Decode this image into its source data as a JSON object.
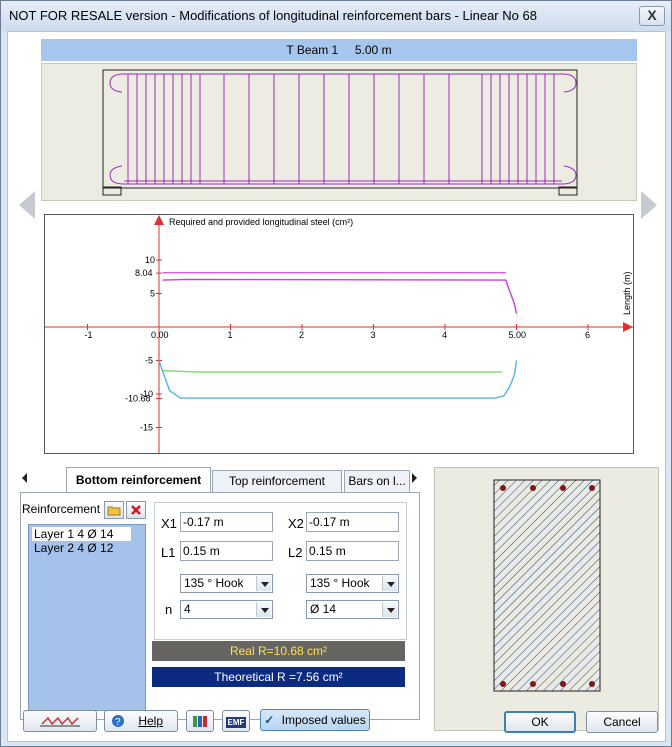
{
  "window": {
    "title": "NOT FOR RESALE version - Modifications of longitudinal reinforcement bars - Linear No 68",
    "close_label": "X"
  },
  "beam": {
    "header": "T Beam 1     5.00 m"
  },
  "chart_data": {
    "type": "line",
    "title": "Required and provided longitudinal steel (cm²)",
    "xlabel": "Length (m)",
    "ylabel": "",
    "xlim": [
      -1.9,
      6.5
    ],
    "ylim": [
      -17,
      15
    ],
    "x_ticks": [
      "-1",
      "0.00",
      "1",
      "2",
      "3",
      "4",
      "5.00",
      "6"
    ],
    "y_ticks": [
      "10",
      "8.04",
      "5",
      "0",
      "-5",
      "-10",
      "-10.68",
      "-15"
    ],
    "series": [
      {
        "color": "#c63fd8",
        "x": [
          0.05,
          0.4,
          4.85,
          4.9,
          4.97,
          5.0
        ],
        "y": [
          7.0,
          7.1,
          7.0,
          5.5,
          3.5,
          2.0
        ]
      },
      {
        "color": "#d45be3",
        "x": [
          0.05,
          4.85
        ],
        "y": [
          8.1,
          8.1
        ]
      },
      {
        "color": "#7fde6a",
        "x": [
          0.05,
          0.5,
          4.8
        ],
        "y": [
          -6.5,
          -6.7,
          -6.7
        ]
      },
      {
        "color": "#4fb6e6",
        "x": [
          0.0,
          0.08,
          0.15,
          0.3,
          4.7,
          4.82,
          4.9,
          4.97,
          5.0
        ],
        "y": [
          -5.0,
          -7.5,
          -9.5,
          -10.6,
          -10.6,
          -10.3,
          -9.0,
          -7.2,
          -5.0
        ]
      }
    ],
    "grid": false
  },
  "tabs": [
    {
      "label": "Bottom reinforcement"
    },
    {
      "label": "Top reinforcement"
    },
    {
      "label": "Bars on l..."
    }
  ],
  "reinforcement": {
    "label": "Reinforcement",
    "layers": [
      "Layer 1 4 Ø 14",
      "Layer 2 4 Ø 12"
    ]
  },
  "params": {
    "x1_label": "X1",
    "x1_value": "-0.17 m",
    "x2_label": "X2",
    "x2_value": "-0.17 m",
    "l1_label": "L1",
    "l1_value": "0.15 m",
    "l2_label": "L2",
    "l2_value": "0.15 m",
    "hook_left": "135 ° Hook",
    "hook_right": "135 ° Hook",
    "n_label": "n",
    "n_value": "4",
    "diameter_value": "Ø 14"
  },
  "results": {
    "real": "Real R=10.68 cm²",
    "theoretical": "Theoretical R =7.56 cm²"
  },
  "buttons": {
    "help": "Help",
    "imposed": "Imposed values",
    "ok": "OK",
    "cancel": "Cancel",
    "emf": "EMF"
  },
  "colors": {
    "rebar": "#9a2bb8",
    "real_bar_bg": "#676562",
    "real_bar_text": "#ffe04a",
    "theo_bar_bg": "#0b2a80",
    "layer_list_bg": "#a5c2ea",
    "axis": "#e03030"
  }
}
